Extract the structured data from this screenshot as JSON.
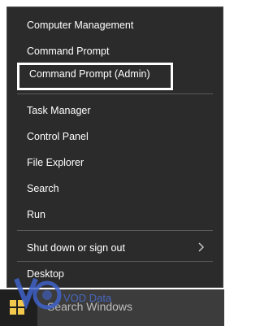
{
  "menu": {
    "items": [
      {
        "label": "Computer Management"
      },
      {
        "label": "Command Prompt"
      },
      {
        "label": "Command Prompt (Admin)",
        "selected": true
      },
      {
        "label": "Task Manager"
      },
      {
        "label": "Control Panel"
      },
      {
        "label": "File Explorer"
      },
      {
        "label": "Search"
      },
      {
        "label": "Run"
      },
      {
        "label": "Shut down or sign out",
        "has_submenu": true
      },
      {
        "label": "Desktop"
      }
    ]
  },
  "taskbar": {
    "search_placeholder": "Search Windows",
    "start_icon": "windows-logo-icon"
  },
  "watermark": {
    "text": "VOD Data",
    "color": "#4a6fd6"
  },
  "colors": {
    "menu_bg": "#2b2b2b",
    "taskbar_bg": "#2d2d2d",
    "search_bg": "#3c3c3c",
    "selection_border": "#ffffff",
    "windows_logo": "#f2c94c"
  }
}
